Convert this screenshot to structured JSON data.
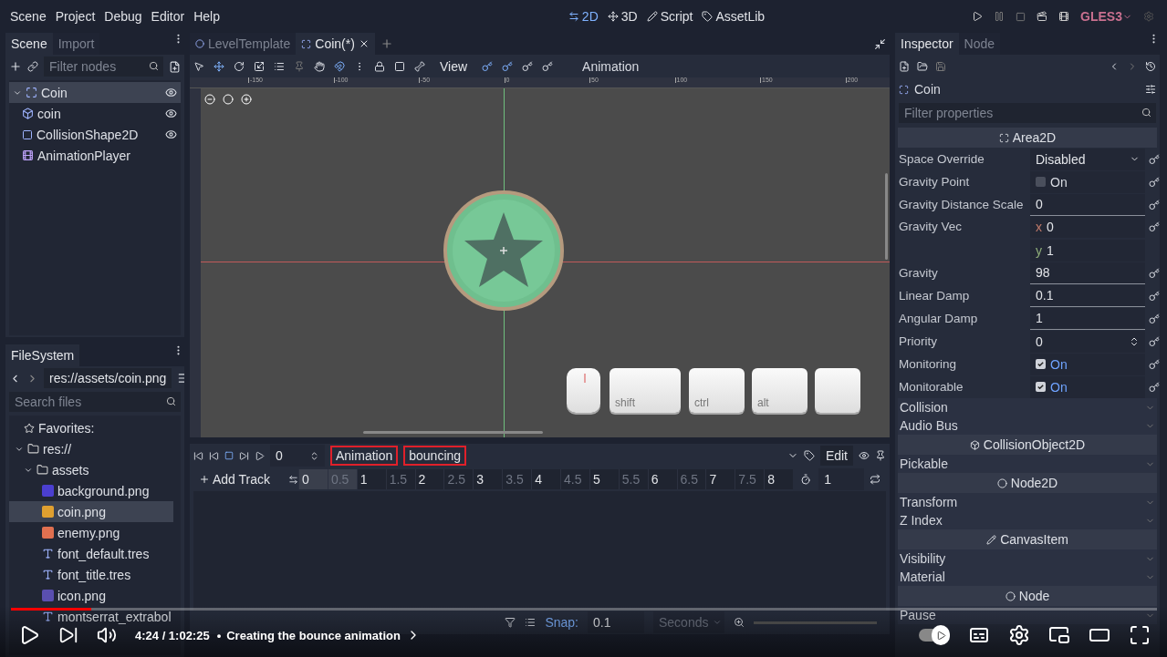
{
  "menu": [
    "Scene",
    "Project",
    "Debug",
    "Editor",
    "Help"
  ],
  "workspaces": [
    {
      "label": "2D",
      "selected": true
    },
    {
      "label": "3D",
      "selected": false
    },
    {
      "label": "Script",
      "selected": false
    },
    {
      "label": "AssetLib",
      "selected": false
    }
  ],
  "renderer": "GLES3",
  "scene_dock": {
    "tabs": [
      {
        "label": "Scene",
        "selected": true
      },
      {
        "label": "Import",
        "selected": false
      }
    ],
    "filter_placeholder": "Filter nodes",
    "tree": [
      {
        "name": "Coin",
        "kind": "area",
        "selected": true,
        "eye": true,
        "children": [
          {
            "name": "coin",
            "kind": "sprite",
            "selected": false,
            "eye": true
          },
          {
            "name": "CollisionShape2D",
            "kind": "shape",
            "selected": false,
            "eye": true
          },
          {
            "name": "AnimationPlayer",
            "kind": "animation",
            "selected": false,
            "eye": false
          }
        ]
      }
    ]
  },
  "filesystem": {
    "tab": "FileSystem",
    "path": "res://assets/coin.png",
    "search_placeholder": "Search files",
    "tree": [
      {
        "name": "Favorites:",
        "kind": "favorites",
        "selected": false
      },
      {
        "name": "res://",
        "kind": "folder",
        "selected": false,
        "children": [
          {
            "name": "assets",
            "kind": "folder",
            "selected": false,
            "children": [
              {
                "name": "background.png",
                "kind": "image",
                "color": "#4b3fd0",
                "selected": false
              },
              {
                "name": "coin.png",
                "kind": "image",
                "color": "#e0a030",
                "selected": true
              },
              {
                "name": "enemy.png",
                "kind": "image",
                "color": "#e07050",
                "selected": false
              },
              {
                "name": "font_default.tres",
                "kind": "font",
                "selected": false
              },
              {
                "name": "font_title.tres",
                "kind": "font",
                "selected": false
              },
              {
                "name": "icon.png",
                "kind": "image",
                "color": "#5a4fb0",
                "selected": false
              },
              {
                "name": "montserrat_extrabol",
                "kind": "font",
                "selected": false
              }
            ]
          }
        ]
      }
    ]
  },
  "editor_tabs": [
    {
      "label": "LevelTemplate",
      "selected": false
    },
    {
      "label": "Coin(*)",
      "selected": true
    }
  ],
  "toolbar": {
    "view_menu": "View",
    "animation_label": "Animation"
  },
  "ruler": [
    "-150",
    "-100",
    "-50",
    "0",
    "50",
    "100",
    "150",
    "200"
  ],
  "keys": [
    {
      "kind": "mouse"
    },
    {
      "kind": "key",
      "label": "shift"
    },
    {
      "kind": "key",
      "label": "ctrl"
    },
    {
      "kind": "key",
      "label": "alt"
    },
    {
      "kind": "key"
    }
  ],
  "animation": {
    "time": "0",
    "label": "Animation",
    "name": "bouncing",
    "annotated": true,
    "edit": "Edit",
    "add_track": "Add Track",
    "ticks": [
      {
        "label": "0",
        "major": true
      },
      {
        "label": "0.5",
        "major": false
      },
      {
        "label": "1",
        "major": true
      },
      {
        "label": "1.5",
        "major": false
      },
      {
        "label": "2",
        "major": true
      },
      {
        "label": "2.5",
        "major": false
      },
      {
        "label": "3",
        "major": true
      },
      {
        "label": "3.5",
        "major": false
      },
      {
        "label": "4",
        "major": true
      },
      {
        "label": "4.5",
        "major": false
      },
      {
        "label": "5",
        "major": true
      },
      {
        "label": "5.5",
        "major": false
      },
      {
        "label": "6",
        "major": true
      },
      {
        "label": "6.5",
        "major": false
      },
      {
        "label": "7",
        "major": true
      },
      {
        "label": "7.5",
        "major": false
      },
      {
        "label": "8",
        "major": true
      }
    ],
    "length": "1",
    "snap_label": "Snap:",
    "snap": "0.1",
    "unit": "Seconds"
  },
  "inspector": {
    "tabs": [
      {
        "label": "Inspector",
        "selected": true
      },
      {
        "label": "Node",
        "selected": false
      }
    ],
    "object": "Coin",
    "filter_placeholder": "Filter properties",
    "rows": [
      {
        "kind": "header",
        "label": "Area2D"
      },
      {
        "kind": "enum",
        "label": "Space Override",
        "value": "Disabled"
      },
      {
        "kind": "check",
        "label": "Gravity Point",
        "value": "On",
        "checked": false
      },
      {
        "kind": "number",
        "label": "Gravity Distance Scale",
        "value": "0"
      },
      {
        "kind": "vector",
        "label": "Gravity Vec",
        "components": [
          {
            "axis": "x",
            "value": "0"
          },
          {
            "axis": "y",
            "value": "1"
          }
        ]
      },
      {
        "kind": "number",
        "label": "Gravity",
        "value": "98"
      },
      {
        "kind": "number",
        "label": "Linear Damp",
        "value": "0.1"
      },
      {
        "kind": "number",
        "label": "Angular Damp",
        "value": "1"
      },
      {
        "kind": "spin",
        "label": "Priority",
        "value": "0"
      },
      {
        "kind": "check",
        "label": "Monitoring",
        "value": "On",
        "checked": true
      },
      {
        "kind": "check",
        "label": "Monitorable",
        "value": "On",
        "checked": true
      },
      {
        "kind": "group",
        "label": "Collision"
      },
      {
        "kind": "group",
        "label": "Audio Bus"
      },
      {
        "kind": "header",
        "label": "CollisionObject2D"
      },
      {
        "kind": "group",
        "label": "Pickable"
      },
      {
        "kind": "header",
        "label": "Node2D"
      },
      {
        "kind": "group",
        "label": "Transform"
      },
      {
        "kind": "group",
        "label": "Z Index"
      },
      {
        "kind": "header",
        "label": "CanvasItem"
      },
      {
        "kind": "group",
        "label": "Visibility"
      },
      {
        "kind": "group",
        "label": "Material"
      },
      {
        "kind": "header",
        "label": "Node"
      },
      {
        "kind": "group",
        "label": "Pause"
      }
    ]
  },
  "video": {
    "level": 0.07,
    "time": "4:24 / 1:02:25",
    "separator": "•",
    "chapter": "Creating the bounce animation",
    "autoplay": true
  }
}
